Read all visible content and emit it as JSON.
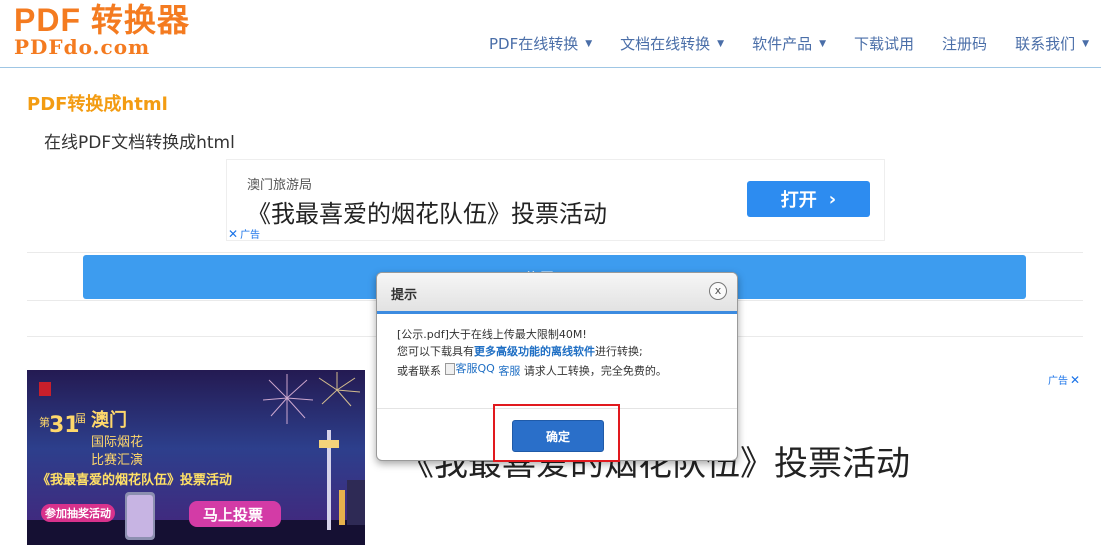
{
  "logo": {
    "main": "PDF 转换器",
    "sub": "PDFdo.com"
  },
  "nav": [
    {
      "label": "PDF在线转换",
      "has_dropdown": true
    },
    {
      "label": "文档在线转换",
      "has_dropdown": true
    },
    {
      "label": "软件产品",
      "has_dropdown": true
    },
    {
      "label": "下载试用",
      "has_dropdown": false
    },
    {
      "label": "注册码",
      "has_dropdown": false
    },
    {
      "label": "联系我们",
      "has_dropdown": true
    }
  ],
  "caret": "▼",
  "page": {
    "title": "PDF转换成html",
    "subtitle": "在线PDF文档转换成html"
  },
  "ad_top": {
    "advertiser": "澳门旅游局",
    "headline": "《我最喜爱的烟花队伍》投票活动",
    "button": "打开",
    "chevron": "›",
    "ad_label": "广告"
  },
  "upload_button": {
    "label": "公示.pdf"
  },
  "ad_bottom": {
    "ad_label": "广告",
    "headline": "《我最喜爱的烟花队伍》投票活动",
    "image": {
      "number": "31",
      "number_prefix": "第",
      "number_suffix": "届",
      "city": "澳门",
      "event_line1": "国际烟花",
      "event_line2": "比赛汇演",
      "campaign": "《我最喜爱的烟花队伍》投票活动",
      "lottery": "参加抽奖活动",
      "vote_button": "马上投票"
    }
  },
  "modal": {
    "title": "提示",
    "close": "x",
    "line1": "[公示.pdf]大于在线上传最大限制40M!",
    "line2_pre": "您可以下载具有",
    "line2_link": "更多高级功能的离线软件",
    "line2_post": "进行转换;",
    "line3_pre": "或者联系",
    "line3_img_alt": "客服QQ",
    "line3_link": "客服",
    "line3_post": "请求人工转换，完全免费的。",
    "ok": "确定"
  },
  "colors": {
    "logo": "#f47b20",
    "nav": "#4a6ea8",
    "title": "#f39c12",
    "primary": "#3d9cef",
    "ad_button": "#2d8cf0",
    "modal_ok": "#2a6fc9",
    "highlight": "#e1191e"
  }
}
